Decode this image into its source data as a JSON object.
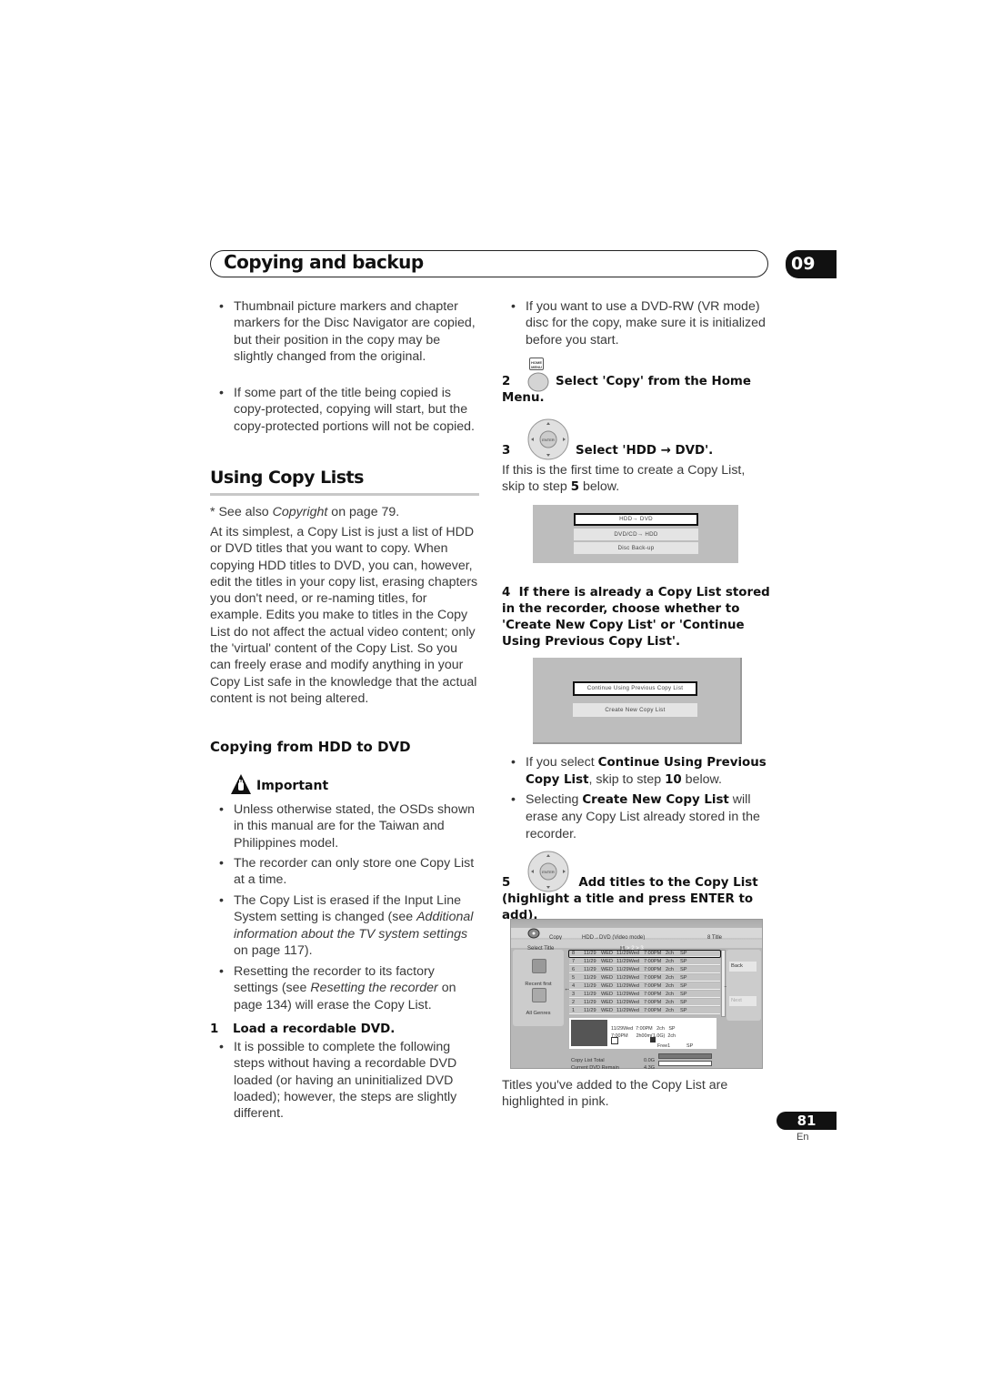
{
  "header": {
    "section_title": "Copying and backup",
    "chapter_number": "09"
  },
  "left_column": {
    "intro_bullets": [
      "Thumbnail picture markers and chapter markers for the Disc Navigator are copied, but their position in the copy may be slightly changed from the original.",
      "If some part of the title being copied is copy-protected, copying will start, but the copy-protected portions will not be copied."
    ],
    "section_heading": "Using Copy Lists",
    "see_also": {
      "prefix": "* See also ",
      "ref": "Copyright",
      "suffix": " on page 79."
    },
    "intro_paragraph": "At its simplest, a Copy List is just a list of HDD or DVD titles that you want to copy. When copying HDD titles to DVD, you can, however, edit the titles in your copy list, erasing chapters you don't need, or re-naming titles, for example. Edits you make to titles in the Copy List do not affect the actual video content; only the 'virtual' content of the Copy List. So you can freely erase and modify anything in your Copy List safe in the knowledge that the actual content is not being altered.",
    "subheading": "Copying from HDD to DVD",
    "important_label": "Important",
    "important_bullets": {
      "b1": "Unless otherwise stated, the OSDs shown in this manual are for the Taiwan and Philippines model.",
      "b2": "The recorder can only store one Copy List at a time.",
      "b3_pre": "The Copy List is erased if the Input Line System setting is changed (see ",
      "b3_ref": "Additional information about the TV system settings",
      "b3_post": " on page 117).",
      "b4_pre": "Resetting the recorder to its factory settings (see ",
      "b4_ref": "Resetting the recorder",
      "b4_post": " on page 134) will erase the Copy List."
    },
    "step1": {
      "number": "1",
      "title": "Load a recordable DVD.",
      "bullet": "It is possible to complete the following steps without having a recordable DVD loaded (or having an uninitialized DVD loaded); however, the steps are slightly different."
    }
  },
  "right_column": {
    "top_bullet": "If you want to use a DVD-RW (VR mode) disc for the copy, make sure it is initialized before you start.",
    "step2": {
      "number": "2",
      "button_label": "HOME MENU",
      "title": "Select 'Copy' from the Home Menu."
    },
    "step3": {
      "number": "3",
      "title": "Select 'HDD → DVD'.",
      "note_pre": "If this is the first time to create a Copy List, skip to step ",
      "note_step": "5",
      "note_post": " below."
    },
    "osd1": {
      "options": [
        "HDD→ DVD",
        "DVD/CD→ HDD",
        "Disc Back-up"
      ],
      "selected_index": 0
    },
    "step4": {
      "number": "4",
      "title": "If there is already a Copy List stored in the recorder, choose whether to 'Create New Copy List' or 'Continue Using Previous Copy List'."
    },
    "osd2": {
      "options": [
        "Continue Using Previous Copy List",
        "Create New Copy List"
      ],
      "selected_index": 0
    },
    "step4_bullets": {
      "b1_pre": "If you select ",
      "b1_bold": "Continue Using Previous Copy List",
      "b1_mid": ", skip to step ",
      "b1_step": "10",
      "b1_post": " below.",
      "b2_pre": "Selecting ",
      "b2_bold": "Create New Copy List",
      "b2_post": " will erase any Copy List already stored in the recorder."
    },
    "step5": {
      "number": "5",
      "title": "Add titles to the Copy List (highlight a title and press ENTER to add)."
    },
    "osd3": {
      "menu_label": "Copy",
      "mode": "HDD→DVD (Video mode)",
      "title_count": "8 Title",
      "select_title": "Select Title",
      "pages": [
        "1",
        "2",
        "3"
      ],
      "sort_label": "Recent first",
      "genre_label": "All Genres",
      "rows": [
        {
          "no": "8",
          "date": "11/29",
          "day": "WED",
          "rec": "11/29Wed",
          "time": "7:00PM",
          "ch": "2ch",
          "mode": "SP"
        },
        {
          "no": "7",
          "date": "11/29",
          "day": "WED",
          "rec": "11/29Wed",
          "time": "7:00PM",
          "ch": "2ch",
          "mode": "SP"
        },
        {
          "no": "6",
          "date": "11/29",
          "day": "WED",
          "rec": "11/29Wed",
          "time": "7:00PM",
          "ch": "2ch",
          "mode": "SP"
        },
        {
          "no": "5",
          "date": "11/29",
          "day": "WED",
          "rec": "11/29Wed",
          "time": "7:00PM",
          "ch": "2ch",
          "mode": "SP"
        },
        {
          "no": "4",
          "date": "11/29",
          "day": "WED",
          "rec": "11/29Wed",
          "time": "7:00PM",
          "ch": "2ch",
          "mode": "SP"
        },
        {
          "no": "3",
          "date": "11/29",
          "day": "WED",
          "rec": "11/29Wed",
          "time": "7:00PM",
          "ch": "2ch",
          "mode": "SP"
        },
        {
          "no": "2",
          "date": "11/29",
          "day": "WED",
          "rec": "11/29Wed",
          "time": "7:00PM",
          "ch": "2ch",
          "mode": "SP"
        },
        {
          "no": "1",
          "date": "11/29",
          "day": "WED",
          "rec": "11/29Wed",
          "time": "7:00PM",
          "ch": "2ch",
          "mode": "SP"
        }
      ],
      "back_label": "Back",
      "next_label": "Next",
      "detail": {
        "line1": "11/29Wed  7:00PM   2ch   SP",
        "line2": "7:00PM      2h00m(1.0G)  2ch",
        "free": "Free1",
        "mode": "SP"
      },
      "copy_list_total_label": "Copy List Total",
      "copy_list_total_value": "0.0G",
      "copy_list_total_fill": 1.0,
      "dvd_remain_label": "Current DVD Remain",
      "dvd_remain_value": "4.3G",
      "dvd_remain_fill": 0.0
    },
    "caption": "Titles you've added to the Copy List are highlighted in pink."
  },
  "footer": {
    "page_number": "81",
    "language": "En"
  }
}
